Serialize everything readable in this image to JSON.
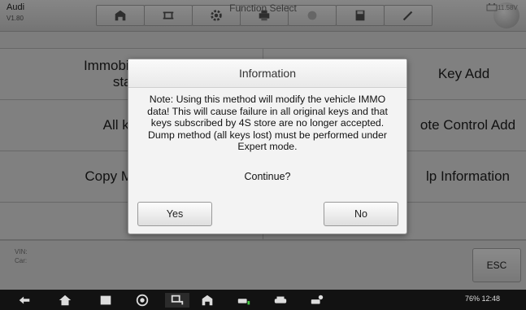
{
  "app": {
    "brand": "Audi",
    "version": "V1.80"
  },
  "toolbar": {
    "buttons": [
      {
        "icon": "home-icon"
      },
      {
        "icon": "vehicle-lift-icon"
      },
      {
        "icon": "settings-gear-icon"
      },
      {
        "icon": "print-icon"
      },
      {
        "icon": "help-icon"
      },
      {
        "icon": "save-icon"
      },
      {
        "icon": "pen-icon"
      }
    ]
  },
  "header": {
    "title": "Function Select",
    "battery": "11.58V"
  },
  "functions": {
    "left": [
      "Immobilizer sys status",
      "All keys lost",
      "Copy Megamos-4",
      ""
    ],
    "right": [
      "Key Add",
      "ote Control Add",
      "lp Information",
      ""
    ]
  },
  "info": {
    "vin_label": "VIN:",
    "car_label": "Car:",
    "esc_label": "ESC"
  },
  "dialog": {
    "title": "Information",
    "message": "Note: Using this method will modify the vehicle IMMO data! This will cause failure in all original keys and that keys subscribed by 4S store are no longer accepted. Dump method (all keys lost) must be performed under Expert mode.",
    "question": "Continue?",
    "yes_label": "Yes",
    "no_label": "No"
  },
  "system_status": "76% 12:48",
  "colors": {
    "background": "#e9e9e9",
    "navbar": "#121212",
    "overlay": "rgba(0,0,0,0.45)"
  }
}
